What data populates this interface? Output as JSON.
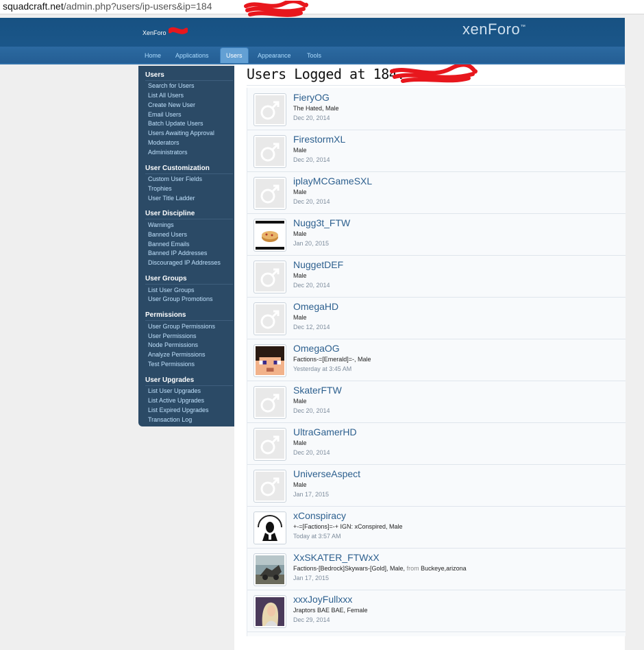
{
  "browser": {
    "url_host": "squadcraft.net",
    "url_path": "/admin.php?users/ip-users&ip=184"
  },
  "header": {
    "site_name": "XenForo",
    "logo": "xenForo",
    "tabs": [
      {
        "label": "Home"
      },
      {
        "label": "Applications"
      },
      {
        "label": "Users",
        "active": true
      },
      {
        "label": "Appearance"
      },
      {
        "label": "Tools"
      }
    ]
  },
  "sidebar": {
    "sections": [
      {
        "title": "Users",
        "items": [
          "Search for Users",
          "List All Users",
          "Create New User",
          "Email Users",
          "Batch Update Users",
          "Users Awaiting Approval",
          "Moderators",
          "Administrators"
        ]
      },
      {
        "title": "User Customization",
        "items": [
          "Custom User Fields",
          "Trophies",
          "User Title Ladder"
        ]
      },
      {
        "title": "User Discipline",
        "items": [
          "Warnings",
          "Banned Users",
          "Banned Emails",
          "Banned IP Addresses",
          "Discouraged IP Addresses"
        ]
      },
      {
        "title": "User Groups",
        "items": [
          "List User Groups",
          "User Group Promotions"
        ]
      },
      {
        "title": "Permissions",
        "items": [
          "User Group Permissions",
          "User Permissions",
          "Node Permissions",
          "Analyze Permissions",
          "Test Permissions"
        ]
      },
      {
        "title": "User Upgrades",
        "items": [
          "List User Upgrades",
          "List Active Upgrades",
          "List Expired Upgrades",
          "Transaction Log"
        ]
      }
    ]
  },
  "main": {
    "title": "Users Logged at 184.",
    "users": [
      {
        "name": "FieryOG",
        "info": "The Hated, Male",
        "date": "Dec 20, 2014",
        "avatar": "default-male-icon"
      },
      {
        "name": "FirestormXL",
        "info": "Male",
        "date": "Dec 20, 2014",
        "avatar": "default-male-icon"
      },
      {
        "name": "iplayMCGameSXL",
        "info": "Male",
        "date": "Dec 20, 2014",
        "avatar": "default-male-icon"
      },
      {
        "name": "Nugg3t_FTW",
        "info": "Male",
        "date": "Jan 20, 2015",
        "avatar": "pie-avatar"
      },
      {
        "name": "NuggetDEF",
        "info": "Male",
        "date": "Dec 20, 2014",
        "avatar": "default-male-icon"
      },
      {
        "name": "OmegaHD",
        "info": "Male",
        "date": "Dec 12, 2014",
        "avatar": "default-male-icon"
      },
      {
        "name": "OmegaOG",
        "info": "Factions-=[Emerald]=-, Male",
        "date": "Yesterday at 3:45 AM",
        "avatar": "pixel-face-avatar"
      },
      {
        "name": "SkaterFTW",
        "info": "Male",
        "date": "Dec 20, 2014",
        "avatar": "default-male-icon"
      },
      {
        "name": "UltraGamerHD",
        "info": "Male",
        "date": "Dec 20, 2014",
        "avatar": "default-male-icon"
      },
      {
        "name": "UniverseAspect",
        "info": "Male",
        "date": "Jan 17, 2015",
        "avatar": "default-male-icon"
      },
      {
        "name": "xConspiracy",
        "info": "+-=[Factions]=-+ IGN: xConspired, Male",
        "date": "Today at 3:57 AM",
        "avatar": "anonymous-avatar"
      },
      {
        "name": "XxSKATER_FTWxX",
        "info": "Factions-[Bedrock]Skywars-[Gold], Male,",
        "info_from": "from",
        "info_location": "Buckeye,arizona",
        "date": "Jan 17, 2015",
        "avatar": "photo-avatar"
      },
      {
        "name": "xxxJoyFullxxx",
        "info": "Jraptors BAE BAE, Female",
        "date": "Dec 29, 2014",
        "avatar": "portrait-avatar"
      }
    ]
  },
  "colors": {
    "header": "#1d5a8e",
    "sidebar": "#2b4a66",
    "link": "#2c5f8e",
    "redaction": "#e8171d"
  }
}
